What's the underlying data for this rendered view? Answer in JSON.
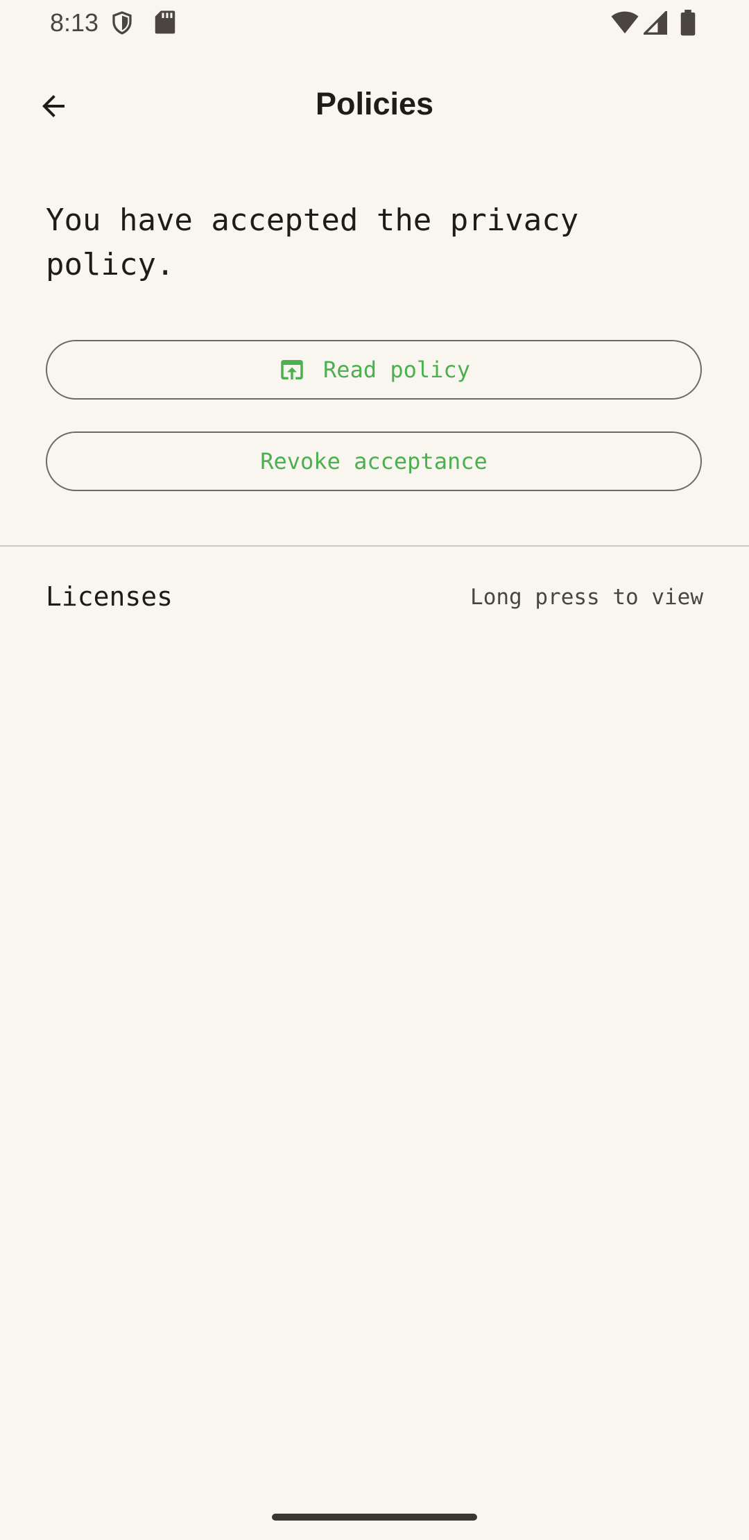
{
  "status_bar": {
    "time": "8:13",
    "left_icons": [
      "shield-icon",
      "sd-card-icon"
    ],
    "right_icons": [
      "wifi-icon",
      "cell-signal-icon",
      "battery-icon"
    ]
  },
  "app_bar": {
    "back_icon": "arrow-back-icon",
    "title": "Policies"
  },
  "content": {
    "message": "You have accepted the privacy policy.",
    "read_button": {
      "label": "Read policy",
      "icon": "open-in-browser-icon"
    },
    "revoke_button": {
      "label": "Revoke acceptance"
    }
  },
  "licenses": {
    "label": "Licenses",
    "hint": "Long press to view"
  },
  "colors": {
    "background": "#f9f6f0",
    "accent": "#4caf50",
    "text": "#1f1b16",
    "outline": "#6f6a60"
  }
}
